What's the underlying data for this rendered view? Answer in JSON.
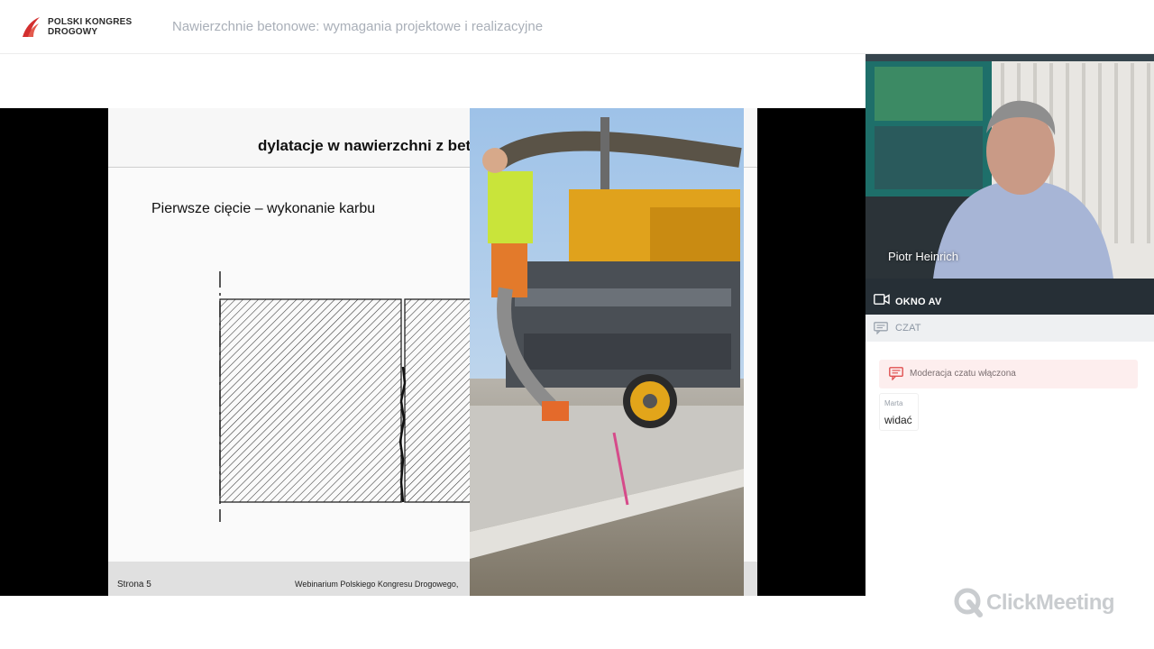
{
  "header": {
    "logo_line1": "POLSKI KONGRES",
    "logo_line2": "DROGOWY",
    "title": "Nawierzchnie betonowe: wymagania projektowe i realizacyjne"
  },
  "slide": {
    "title": "dylatacje w nawierzchni z beto",
    "subtitle": "Pierwsze cięcie – wykonanie karbu",
    "footer_page": "Strona 5",
    "footer_org": "Webinarium Polskiego Kongresu Drogowego,"
  },
  "video": {
    "presenter_name": "Piotr Heinrich"
  },
  "panels": {
    "av_label": "OKNO AV",
    "chat_label": "CZAT"
  },
  "chat": {
    "moderation_notice": "Moderacja czatu włączona",
    "messages": [
      {
        "author": "Marta",
        "text": "widać"
      }
    ]
  },
  "brand": {
    "name": "ClickMeeting"
  },
  "colors": {
    "logo_red": "#d32f2f",
    "av_bar": "#262f36",
    "mod_banner_bg": "#fdeeee",
    "mod_icon": "#e05050"
  },
  "icons": {
    "logo": "pkd-logo-icon",
    "video": "video-camera-icon",
    "chat": "chat-icon",
    "moderation": "chat-moderation-icon",
    "brand": "clickmeeting-logo-icon"
  }
}
